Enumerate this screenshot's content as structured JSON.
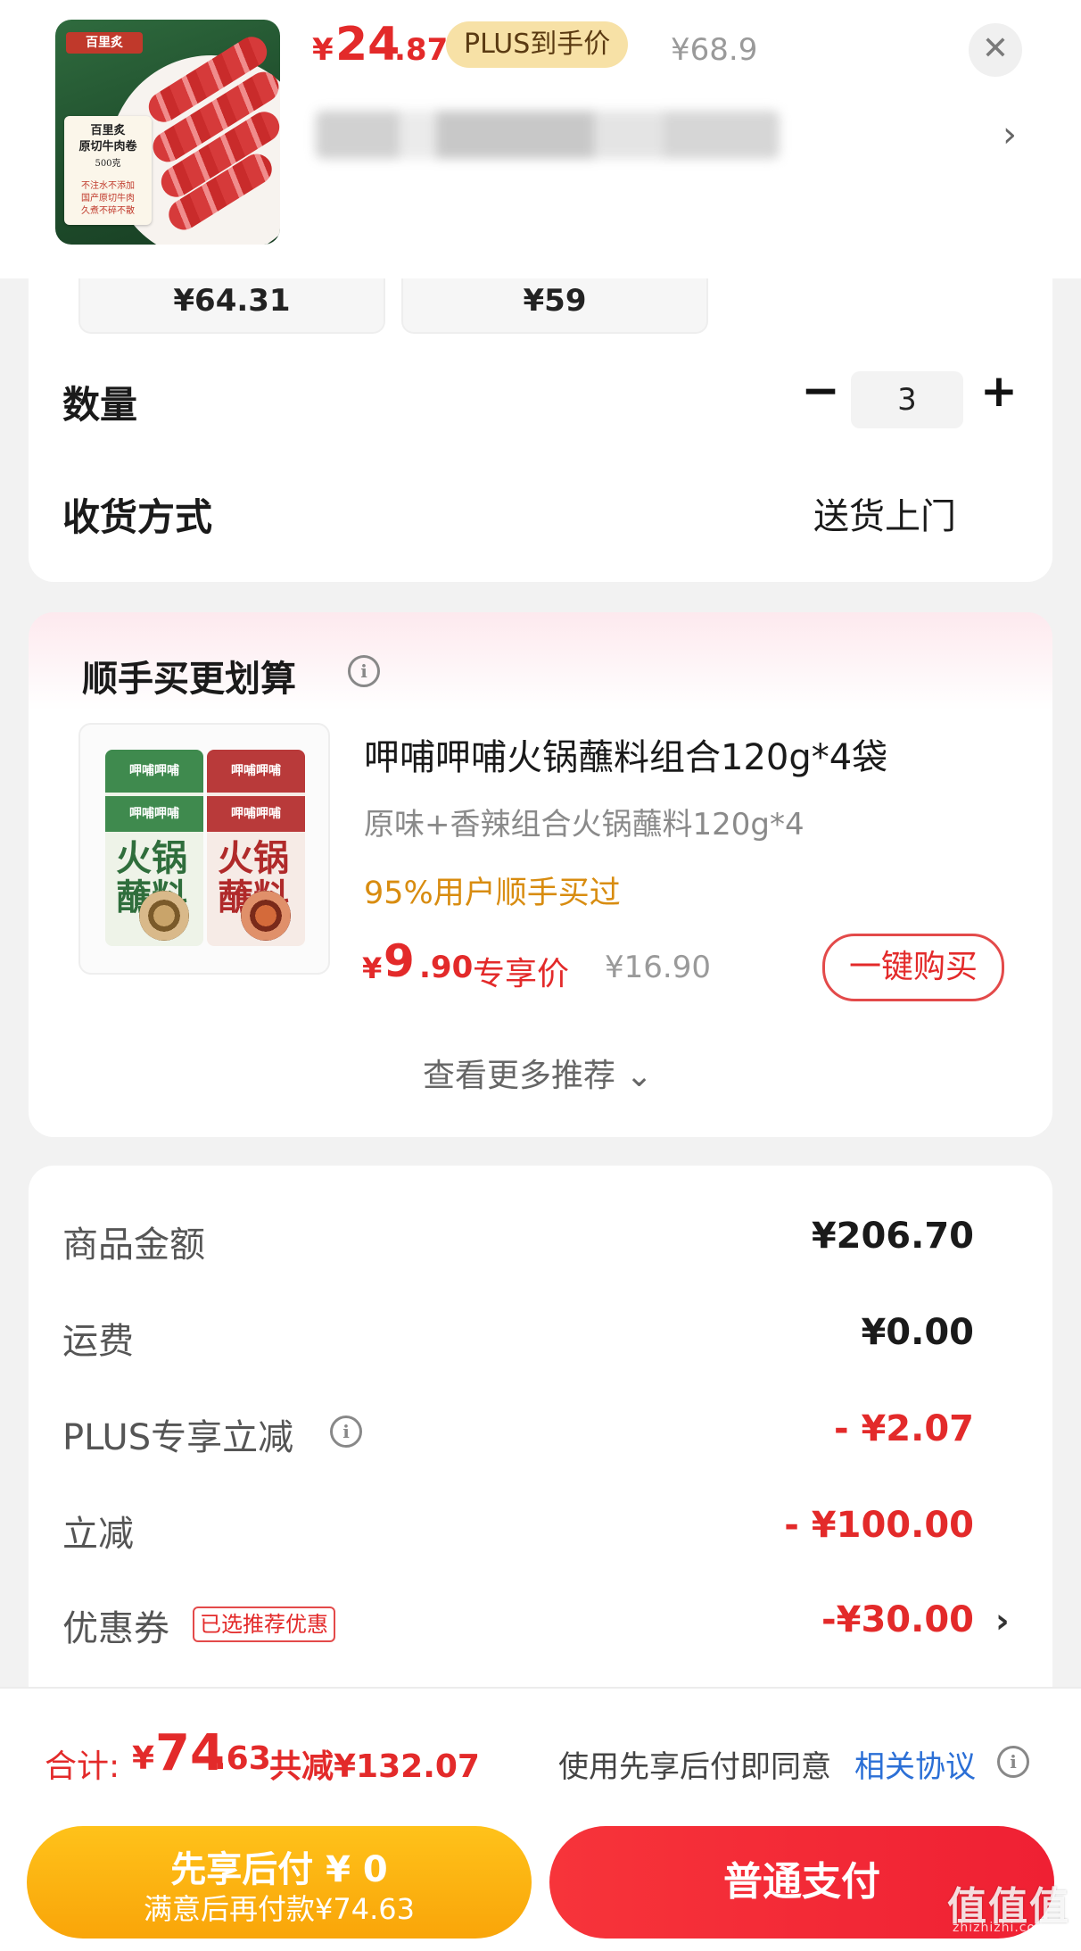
{
  "header": {
    "price_symbol": "¥",
    "price_integer": "24",
    "price_decimal": ".87",
    "plus_badge": "PLUS到手价",
    "original_price": "¥68.9",
    "close_icon": "close-icon",
    "chevron_icon": "chevron-right-icon",
    "thumbnail": {
      "brand": "百里炙",
      "label_line1": "百里炙",
      "label_line2": "原切牛肉卷",
      "label_size": "500克",
      "label_notes": [
        "不注水不添加",
        "国产原切牛肉",
        "久煮不碎不散"
      ]
    }
  },
  "spec": {
    "options": [
      {
        "price": "¥64.31"
      },
      {
        "price": "¥59"
      }
    ],
    "quantity_label": "数量",
    "quantity_value": "3",
    "minus_symbol": "−",
    "plus_symbol": "+",
    "delivery_label": "收货方式",
    "delivery_value": "送货上门"
  },
  "recommend": {
    "title": "顺手买更划算",
    "info_symbol": "i",
    "product_name": "呷哺呷哺火锅蘸料组合120g*4袋",
    "product_desc": "原味+香辣组合火锅蘸料120g*4",
    "social_proof": "95%用户顺手买过",
    "price_symbol": "¥",
    "price_integer": "9",
    "price_decimal": ".90",
    "price_tag": "专享价",
    "original_price": "¥16.90",
    "buy_button": "一键购买",
    "more_link": "查看更多推荐 ⌄",
    "pack": {
      "brand": "呷哺呷哺",
      "big_text": "火锅\n蘸料"
    }
  },
  "summary": {
    "goods_label": "商品金额",
    "goods_value": "¥206.70",
    "shipping_label": "运费",
    "shipping_value": "¥0.00",
    "plus_label": "PLUS专享立减",
    "plus_value": "- ¥2.07",
    "cut_label": "立减",
    "cut_value": "- ¥100.00",
    "coupon_label": "优惠券",
    "coupon_tag": "已选推荐优惠",
    "coupon_value": "-¥30.00"
  },
  "bottom": {
    "total_label": "合计:",
    "total_symbol": "¥",
    "total_integer": "74",
    "total_decimal": ".63",
    "total_saved": "共减¥132.07",
    "agree_text": "使用先享后付即同意",
    "agree_link": "相关协议",
    "pay_later_title": "先享后付 ¥ 0",
    "pay_later_sub": "满意后再付款¥74.63",
    "pay_normal": "普通支付",
    "watermark": "值值值",
    "watermark_sub": "zhizhizhi.com"
  },
  "colors": {
    "accent_red": "#e32a2a",
    "plus_gold": "#f7e1a6",
    "pay_later_yellow": "#ffc21a",
    "link_blue": "#2b6fd6",
    "social_orange": "#d88c10"
  }
}
